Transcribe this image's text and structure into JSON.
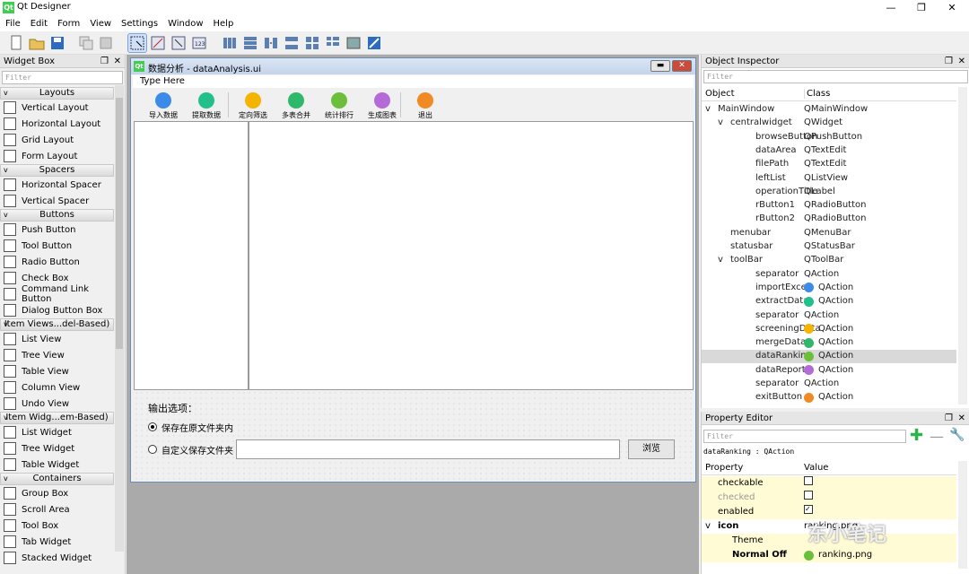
{
  "app": {
    "title": "Qt Designer",
    "logo": "Qt"
  },
  "menubar": [
    "File",
    "Edit",
    "Form",
    "View",
    "Settings",
    "Window",
    "Help"
  ],
  "widget_box": {
    "title": "Widget Box",
    "filter_placeholder": "Filter",
    "sections": [
      {
        "name": "Layouts",
        "items": [
          "Vertical Layout",
          "Horizontal Layout",
          "Grid Layout",
          "Form Layout"
        ]
      },
      {
        "name": "Spacers",
        "items": [
          "Horizontal Spacer",
          "Vertical Spacer"
        ]
      },
      {
        "name": "Buttons",
        "items": [
          "Push Button",
          "Tool Button",
          "Radio Button",
          "Check Box",
          "Command Link Button",
          "Dialog Button Box"
        ]
      },
      {
        "name": "Item Views...del-Based)",
        "items": [
          "List View",
          "Tree View",
          "Table View",
          "Column View",
          "Undo View"
        ]
      },
      {
        "name": "Item Widg...em-Based)",
        "items": [
          "List Widget",
          "Tree Widget",
          "Table Widget"
        ]
      },
      {
        "name": "Containers",
        "items": [
          "Group Box",
          "Scroll Area",
          "Tool Box",
          "Tab Widget",
          "Stacked Widget"
        ]
      }
    ]
  },
  "form": {
    "logo": "Qt",
    "title": "数据分析 - dataAnalysis.ui",
    "menu_placeholder": "Type Here",
    "actions": [
      {
        "label": "导入数据",
        "color": "#3d8be8"
      },
      {
        "label": "提取数据",
        "color": "#22c08a"
      },
      {
        "label": "定向筛选",
        "color": "#f4b400"
      },
      {
        "label": "多表合并",
        "color": "#2fb86a"
      },
      {
        "label": "统计排行",
        "color": "#6cbf3a"
      },
      {
        "label": "生成图表",
        "color": "#b46ad8"
      },
      {
        "label": "退出",
        "color": "#f08a24"
      }
    ],
    "options_label": "输出选项：",
    "radio1": "保存在原文件夹内",
    "radio2": "自定义保存文件夹",
    "browse": "浏览"
  },
  "object_inspector": {
    "title": "Object Inspector",
    "filter_placeholder": "Filter",
    "col_object": "Object",
    "col_class": "Class",
    "rows": [
      {
        "name": "MainWindow",
        "cls": "QMainWindow",
        "indent": 0,
        "arrow": "v",
        "icon": ""
      },
      {
        "name": "centralwidget",
        "cls": "QWidget",
        "indent": 1,
        "arrow": "v",
        "icon": ""
      },
      {
        "name": "browseButton",
        "cls": "QPushButton",
        "indent": 2,
        "arrow": "",
        "icon": ""
      },
      {
        "name": "dataArea",
        "cls": "QTextEdit",
        "indent": 2,
        "arrow": "",
        "icon": ""
      },
      {
        "name": "filePath",
        "cls": "QTextEdit",
        "indent": 2,
        "arrow": "",
        "icon": ""
      },
      {
        "name": "leftList",
        "cls": "QListView",
        "indent": 2,
        "arrow": "",
        "icon": ""
      },
      {
        "name": "operationTitle",
        "cls": "QLabel",
        "indent": 2,
        "arrow": "",
        "icon": ""
      },
      {
        "name": "rButton1",
        "cls": "QRadioButton",
        "indent": 2,
        "arrow": "",
        "icon": ""
      },
      {
        "name": "rButton2",
        "cls": "QRadioButton",
        "indent": 2,
        "arrow": "",
        "icon": ""
      },
      {
        "name": "menubar",
        "cls": "QMenuBar",
        "indent": 1,
        "arrow": "",
        "icon": ""
      },
      {
        "name": "statusbar",
        "cls": "QStatusBar",
        "indent": 1,
        "arrow": "",
        "icon": ""
      },
      {
        "name": "toolBar",
        "cls": "QToolBar",
        "indent": 1,
        "arrow": "v",
        "icon": ""
      },
      {
        "name": "separator",
        "cls": "QAction",
        "indent": 2,
        "arrow": "",
        "icon": ""
      },
      {
        "name": "importExcel",
        "cls": "QAction",
        "indent": 2,
        "arrow": "",
        "icon": "#3d8be8"
      },
      {
        "name": "extractData",
        "cls": "QAction",
        "indent": 2,
        "arrow": "",
        "icon": "#22c08a"
      },
      {
        "name": "separator",
        "cls": "QAction",
        "indent": 2,
        "arrow": "",
        "icon": ""
      },
      {
        "name": "screeningData",
        "cls": "QAction",
        "indent": 2,
        "arrow": "",
        "icon": "#f4b400"
      },
      {
        "name": "mergeData",
        "cls": "QAction",
        "indent": 2,
        "arrow": "",
        "icon": "#2fb86a"
      },
      {
        "name": "dataRanking",
        "cls": "QAction",
        "indent": 2,
        "arrow": "",
        "icon": "#6cbf3a",
        "selected": true
      },
      {
        "name": "dataReport",
        "cls": "QAction",
        "indent": 2,
        "arrow": "",
        "icon": "#b46ad8"
      },
      {
        "name": "separator",
        "cls": "QAction",
        "indent": 2,
        "arrow": "",
        "icon": ""
      },
      {
        "name": "exitButton",
        "cls": "QAction",
        "indent": 2,
        "arrow": "",
        "icon": "#f08a24"
      }
    ]
  },
  "property_editor": {
    "title": "Property Editor",
    "filter_placeholder": "Filter",
    "context": "dataRanking : QAction",
    "col_property": "Property",
    "col_value": "Value",
    "rows": [
      {
        "name": "checkable",
        "value": "",
        "type": "check",
        "checked": false,
        "bold": false,
        "dim": false
      },
      {
        "name": "checked",
        "value": "",
        "type": "check",
        "checked": false,
        "bold": false,
        "dim": true
      },
      {
        "name": "enabled",
        "value": "",
        "type": "check",
        "checked": true,
        "bold": false,
        "dim": false
      },
      {
        "name": "icon",
        "value": "ranking.png",
        "type": "text",
        "bold": true,
        "dim": false,
        "arrow": "v"
      },
      {
        "name": "Theme",
        "value": "",
        "type": "text",
        "bold": false,
        "dim": false
      },
      {
        "name": "Normal Off",
        "value": "ranking.png",
        "type": "icontext",
        "bold": true,
        "dim": false
      }
    ]
  },
  "watermark": "东小笔记",
  "colors": {
    "accent": "#41cd52",
    "selection": "#d9d9d9",
    "prop_highlight": "#fffbd4"
  }
}
